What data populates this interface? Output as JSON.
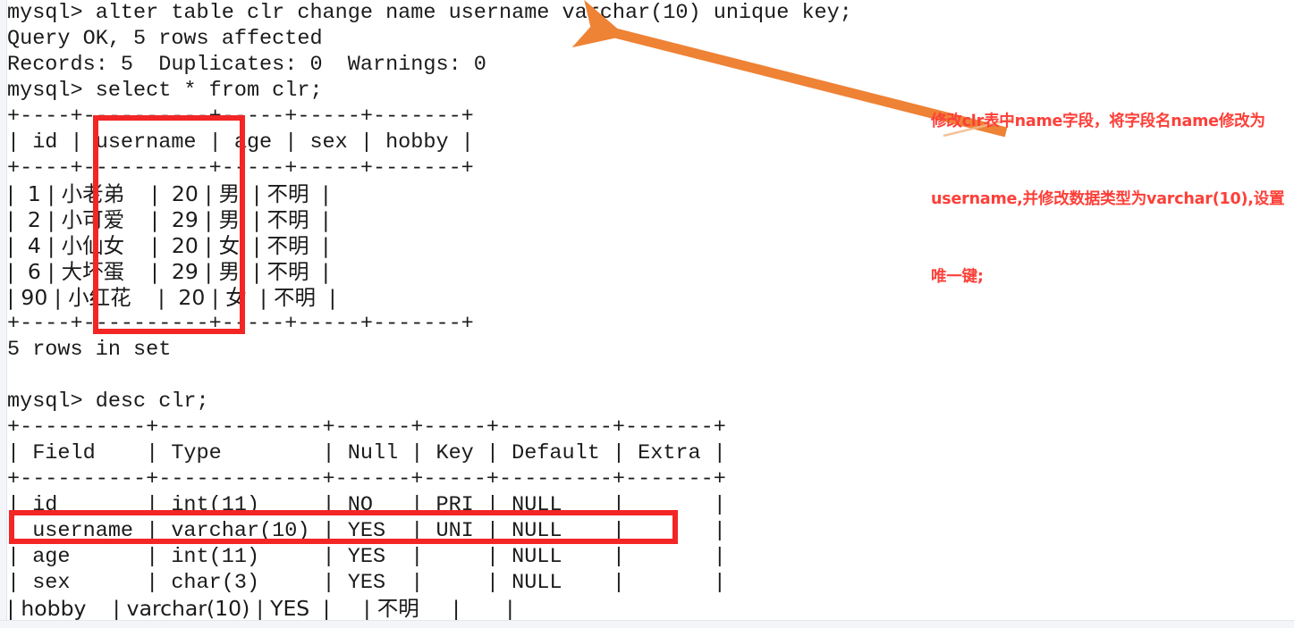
{
  "terminal": {
    "lines": [
      "mysql> alter table clr change name username varchar(10) unique key;",
      "Query OK, 5 rows affected",
      "Records: 5  Duplicates: 0  Warnings: 0",
      "mysql> select * from clr;",
      "+----+----------+-----+-----+-------+",
      "| id | username | age | sex | hobby |",
      "+----+----------+-----+-----+-------+",
      "|  1 | 小老弟    |  20 | 男  | 不明  |",
      "|  2 | 小可爱    |  29 | 男  | 不明  |",
      "|  4 | 小仙女    |  20 | 女  | 不明  |",
      "|  6 | 大坏蛋    |  29 | 男  | 不明  |",
      "| 90 | 小红花    |  20 | 女  | 不明  |",
      "+----+----------+-----+-----+-------+",
      "5 rows in set",
      "",
      "mysql> desc clr;",
      "+----------+-------------+------+-----+---------+-------+",
      "| Field    | Type        | Null | Key | Default | Extra |",
      "+----------+-------------+------+-----+---------+-------+",
      "| id       | int(11)     | NO   | PRI | NULL    |       |",
      "| username | varchar(10) | YES  | UNI | NULL    |       |",
      "| age      | int(11)     | YES  |     | NULL    |       |",
      "| sex      | char(3)     | YES  |     | NULL    |       |",
      "| hobby    | varchar(10) | YES  |     | 不明     |       |"
    ],
    "commands": {
      "alter_statement": "alter table clr change name username varchar(10) unique key;",
      "select_statement": "select * from clr;",
      "desc_statement": "desc clr;",
      "prompt": "mysql>"
    },
    "results": {
      "query_ok": "Query OK, 5 rows affected",
      "records_line": "Records: 5  Duplicates: 0  Warnings: 0",
      "rows_in_set": "5 rows in set"
    }
  },
  "select_table": {
    "headers": [
      "id",
      "username",
      "age",
      "sex",
      "hobby"
    ],
    "rows": [
      [
        "1",
        "小老弟",
        "20",
        "男",
        "不明"
      ],
      [
        "2",
        "小可爱",
        "29",
        "男",
        "不明"
      ],
      [
        "4",
        "小仙女",
        "20",
        "女",
        "不明"
      ],
      [
        "6",
        "大坏蛋",
        "29",
        "男",
        "不明"
      ],
      [
        "90",
        "小红花",
        "20",
        "女",
        "不明"
      ]
    ],
    "row_count_text": "5 rows in set"
  },
  "desc_table": {
    "headers": [
      "Field",
      "Type",
      "Null",
      "Key",
      "Default",
      "Extra"
    ],
    "rows": [
      [
        "id",
        "int(11)",
        "NO",
        "PRI",
        "NULL",
        ""
      ],
      [
        "username",
        "varchar(10)",
        "YES",
        "UNI",
        "NULL",
        ""
      ],
      [
        "age",
        "int(11)",
        "YES",
        "",
        "NULL",
        ""
      ],
      [
        "sex",
        "char(3)",
        "YES",
        "",
        "NULL",
        ""
      ],
      [
        "hobby",
        "varchar(10)",
        "YES",
        "",
        "不明",
        ""
      ]
    ]
  },
  "annotation": {
    "note_line_1": "修改clr表中name字段，将字段名name修改为",
    "note_line_2": "username,并修改数据类型为varchar(10),设置",
    "note_line_3": "唯一键;",
    "note_color": "#fc4039",
    "arrow_color": "#ee8235",
    "highlight_color": "#f42525"
  }
}
